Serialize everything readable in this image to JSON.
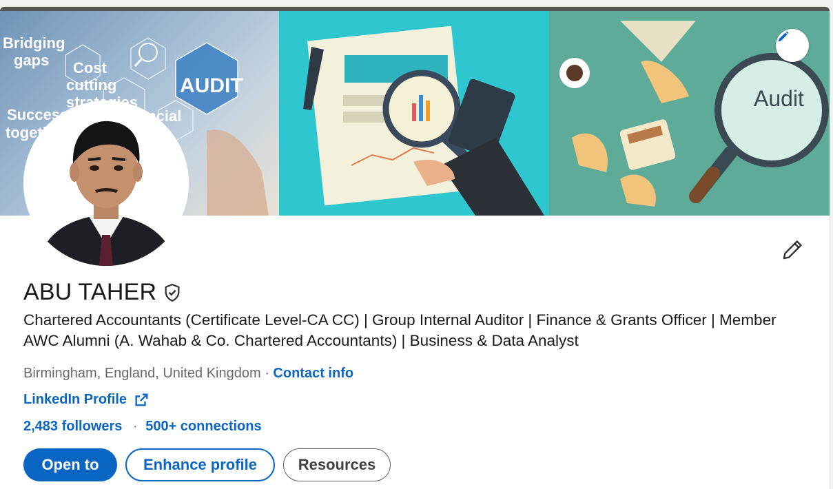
{
  "profile": {
    "name": "ABU TAHER",
    "headline": "Chartered Accountants (Certificate Level-CA CC) | Group Internal Auditor | Finance & Grants Officer | Member AWC Alumni (A. Wahab & Co. Chartered Accountants) | Business & Data Analyst",
    "location": "Birmingham, England, United Kingdom",
    "separator": " · ",
    "contact_info": "Contact info",
    "linkedin_profile": "LinkedIn Profile",
    "followers": "2,483 followers",
    "dot": "·",
    "connections": "500+ connections"
  },
  "banner": {
    "text_bridging": "Bridging",
    "text_gaps": "gaps",
    "text_cost": "Cost",
    "text_cutting": "cutting",
    "text_strategies": "strategies",
    "text_success": "Success",
    "text_together": "together",
    "text_financial": "Financial",
    "text_audit_hex": "AUDIT",
    "text_audit_lens": "Audit"
  },
  "actions": {
    "open_to": "Open to",
    "enhance_profile": "Enhance profile",
    "resources": "Resources"
  },
  "colors": {
    "accent": "#0a66c2",
    "panel_teal": "#2fc7cf",
    "panel_green": "#5fab99"
  }
}
